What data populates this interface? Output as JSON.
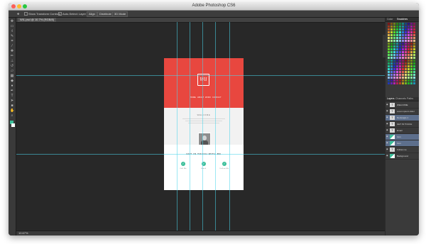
{
  "window": {
    "title": "Adobe Photoshop CS6"
  },
  "options_bar": {
    "items": [
      "Show Transform Controls",
      "Auto-Select: Layer"
    ],
    "buttons": [
      "Align",
      "Distribute",
      "3D Mode"
    ]
  },
  "document": {
    "tab_label": "WIL.psd @ 10.7% (RGB/8)"
  },
  "status_bar": {
    "zoom": "10.67%"
  },
  "canvas": {
    "logo": "Wil",
    "nav": [
      "HOME",
      "ABOUT",
      "WORK",
      "CONTACT"
    ],
    "about_heading": "WELCOME",
    "contact_heading": "GET IN TOUCH WITH ME",
    "contact_items": [
      "Call Me",
      "Email",
      "Follow Me"
    ]
  },
  "right_panel": {
    "swatch_tabs": [
      "Color",
      "Swatches"
    ],
    "layers_tabs": [
      "Layers",
      "Channels",
      "Paths"
    ],
    "layers": [
      {
        "name": "WELCOME",
        "type": "T",
        "selected": false
      },
      {
        "name": "Lorem ipsum dolor",
        "type": "T",
        "selected": false
      },
      {
        "name": "Rectangle 1",
        "type": "T",
        "selected": true
      },
      {
        "name": "GET IN TOUCH",
        "type": "T",
        "selected": false
      },
      {
        "name": "Email",
        "type": "T",
        "selected": false
      },
      {
        "name": "Icon",
        "type": "img",
        "selected": true
      },
      {
        "name": "Icon",
        "type": "img",
        "selected": true
      },
      {
        "name": "Follow me",
        "type": "T",
        "selected": false
      },
      {
        "name": "Background",
        "type": "img",
        "selected": false
      }
    ]
  },
  "colors": {
    "hero": "#e8473f",
    "accent": "#3cbf9a",
    "guides": "#4ad6eb",
    "workspace": "#282828"
  }
}
